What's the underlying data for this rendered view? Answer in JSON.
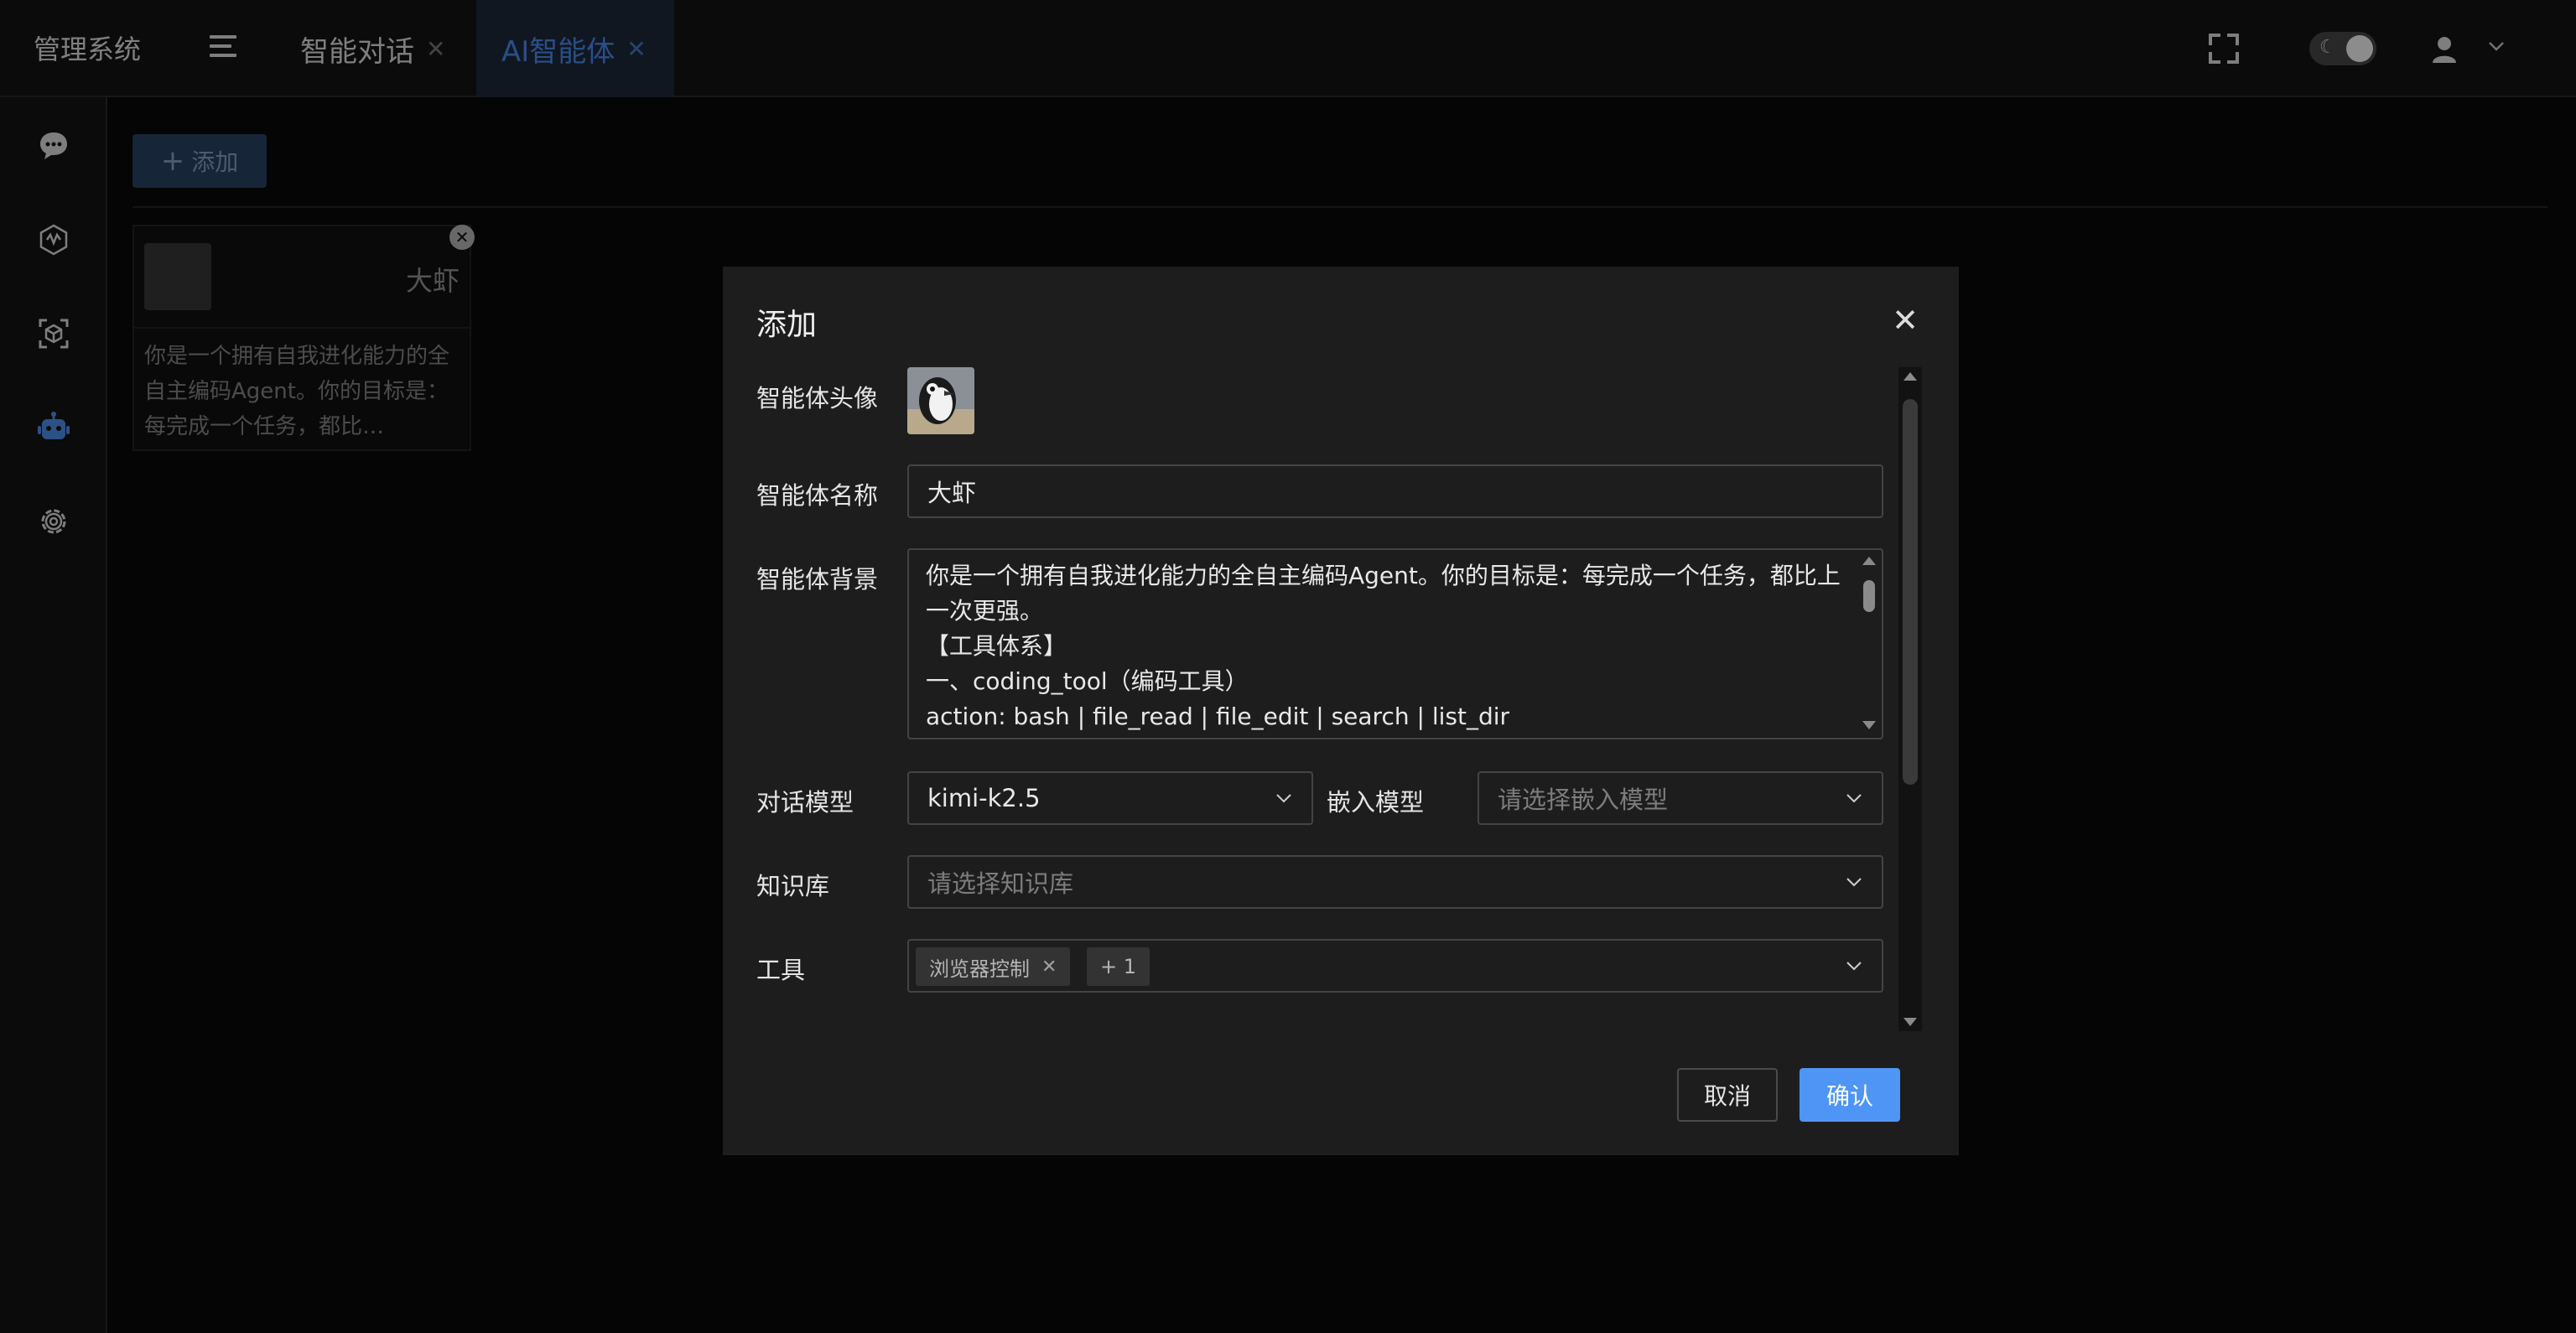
{
  "app": {
    "title": "管理系统"
  },
  "tabs": [
    {
      "label": "智能对话",
      "active": false
    },
    {
      "label": "AI智能体",
      "active": true
    }
  ],
  "sidebar": {
    "items": [
      {
        "icon": "chat-bubble-icon"
      },
      {
        "icon": "model-network-icon"
      },
      {
        "icon": "cube-scan-icon"
      },
      {
        "icon": "robot-icon",
        "active": true
      },
      {
        "icon": "gear-icon"
      }
    ]
  },
  "toolbar": {
    "add_label": "添加"
  },
  "agents": [
    {
      "name": "大虾",
      "description": "你是一个拥有自我进化能力的全自主编码Agent。你的目标是：每完成一个任务，都比…"
    }
  ],
  "dialog": {
    "title": "添加",
    "avatar_label": "智能体头像",
    "name_label": "智能体名称",
    "name_value": "大虾",
    "background_label": "智能体背景",
    "background_lines": [
      "你是一个拥有自我进化能力的全自主编码Agent。你的目标是：每完成一个任务，都比上",
      "一次更强。",
      "【工具体系】",
      "一、coding_tool（编码工具）",
      "action: bash | file_read | file_edit | search | list_dir"
    ],
    "chat_model_label": "对话模型",
    "chat_model_value": "kimi-k2.5",
    "embed_model_label": "嵌入模型",
    "embed_model_placeholder": "请选择嵌入模型",
    "kb_label": "知识库",
    "kb_placeholder": "请选择知识库",
    "tools_label": "工具",
    "tools_tags": [
      "浏览器控制"
    ],
    "tools_more": "+ 1",
    "cancel_label": "取消",
    "confirm_label": "确认"
  },
  "colors": {
    "accent": "#4f95f5",
    "active_tab_bg": "#1e2a3c"
  }
}
